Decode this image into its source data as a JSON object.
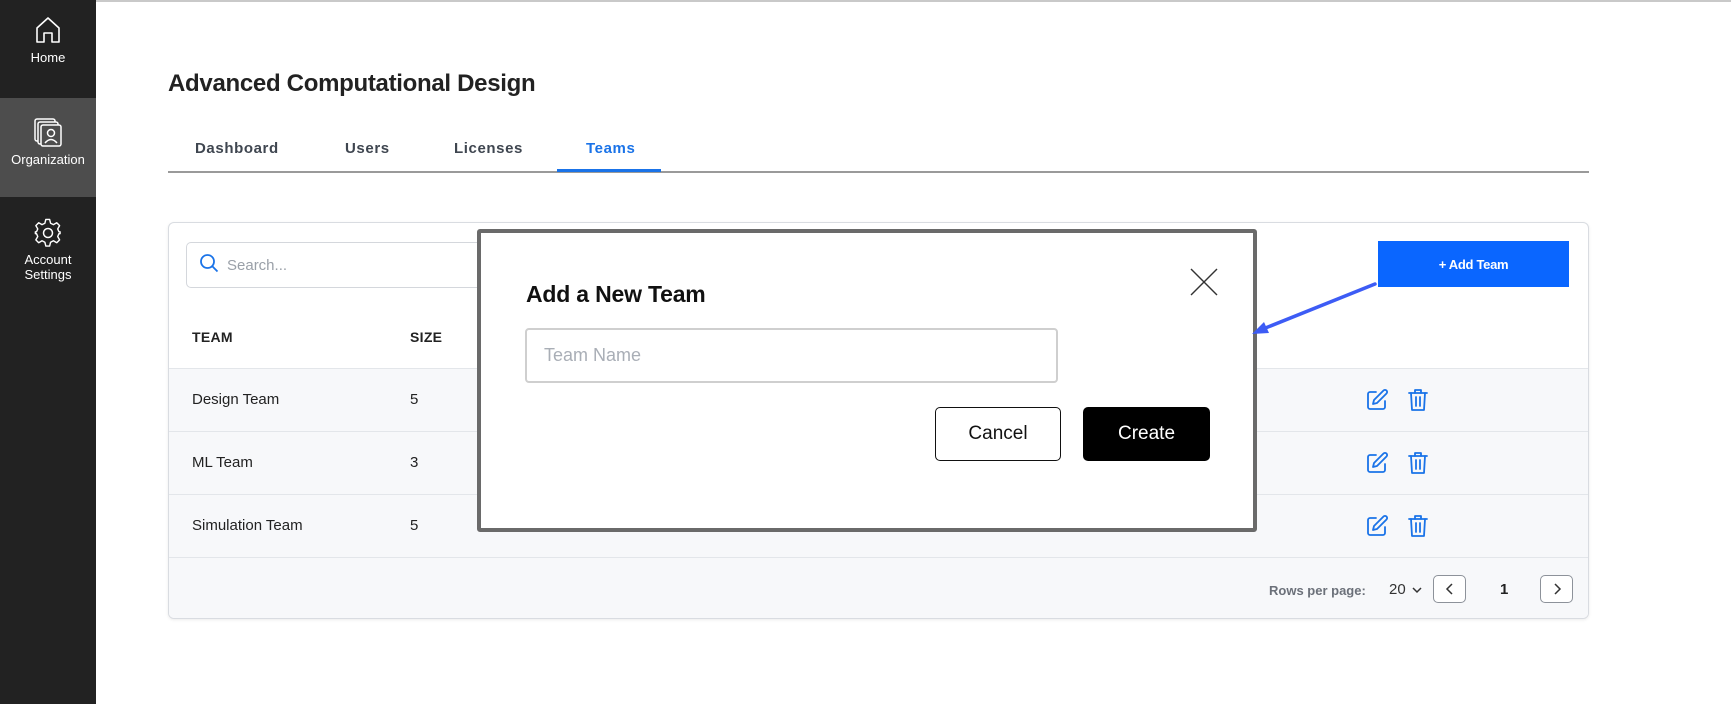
{
  "sidebar": {
    "items": [
      {
        "label": "Home",
        "icon": "home-icon"
      },
      {
        "label": "Organization",
        "icon": "organization-icon",
        "active": true
      },
      {
        "label": "Account\nSettings",
        "icon": "gear-icon"
      }
    ]
  },
  "page": {
    "title": "Advanced Computational Design"
  },
  "tabs": [
    {
      "label": "Dashboard"
    },
    {
      "label": "Users"
    },
    {
      "label": "Licenses"
    },
    {
      "label": "Teams",
      "active": true
    }
  ],
  "search": {
    "placeholder": "Search..."
  },
  "toolbar": {
    "add_team_label": "+ Add Team"
  },
  "table": {
    "columns": [
      "TEAM",
      "SIZE"
    ],
    "rows": [
      {
        "team": "Design Team",
        "size": "5"
      },
      {
        "team": "ML Team",
        "size": "3"
      },
      {
        "team": "Simulation Team",
        "size": "5"
      }
    ]
  },
  "pagination": {
    "rows_per_page_label": "Rows per page:",
    "rows_per_page_value": "20",
    "current_page": "1"
  },
  "modal": {
    "title": "Add a New Team",
    "input_placeholder": "Team Name",
    "input_value": "",
    "cancel_label": "Cancel",
    "create_label": "Create"
  },
  "colors": {
    "accent": "#1a73e8",
    "primary_button": "#0a66ff",
    "sidebar_bg": "#222222",
    "annotation_arrow": "#3d5cf5"
  }
}
